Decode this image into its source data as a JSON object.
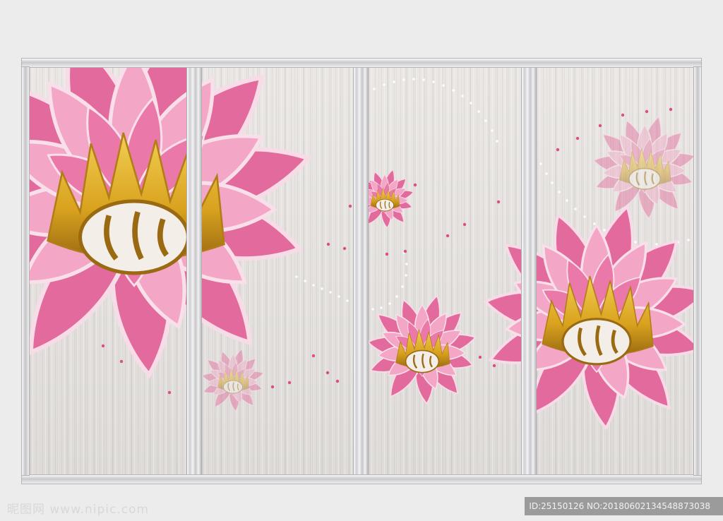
{
  "watermark": {
    "site": "昵图网 www.nipic.com",
    "id_line": "ID:25150126 NO:20180602134548873038"
  },
  "colors": {
    "petal_dark": "#e0689a",
    "petal_light": "#f2a4c4",
    "petal_outline": "#f6dbe6",
    "gold": "#d9a21e",
    "panel": "#e7e4e1",
    "dot_pink": "#d94f86"
  },
  "artwork": {
    "subject": "pink-lotus-flowers",
    "panel_count": 4
  }
}
